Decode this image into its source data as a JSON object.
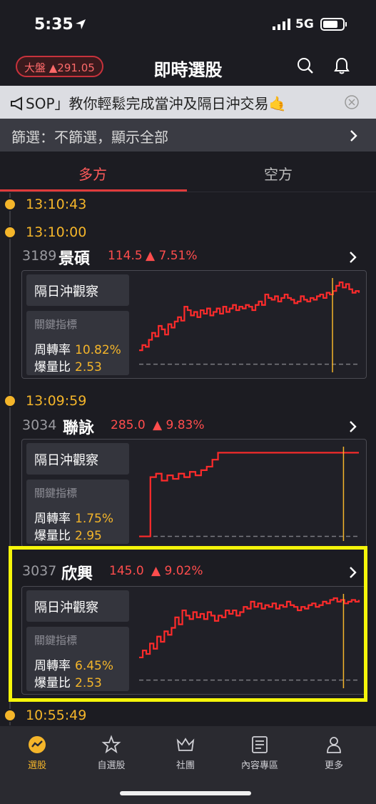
{
  "status_bar": {
    "time": "5:35",
    "network": "5G"
  },
  "header": {
    "market_label": "大盤 ▲291.05",
    "title": "即時選股"
  },
  "notice": {
    "text": "SOP」教你輕鬆完成當沖及隔日沖交易🤙"
  },
  "filter": {
    "label": "篩選：不篩選，顯示全部"
  },
  "tabs": [
    {
      "label": "多方",
      "active": true
    },
    {
      "label": "空方",
      "active": false
    }
  ],
  "timeline": [
    {
      "time": "13:10:43"
    },
    {
      "time": "13:10:00"
    },
    {
      "time": "13:09:59"
    },
    {
      "time": "10:55:49"
    }
  ],
  "stocks": [
    {
      "code": "3189",
      "name": "景碩",
      "price": "114.5",
      "change": "▲ 7.51%",
      "tag": "隔日沖觀察",
      "metrics_title": "關鍵指標",
      "turnover_label": "周轉率",
      "turnover": "10.82%",
      "volume_label": "爆量比",
      "volume_ratio": "2.53",
      "chart": {
        "values": [
          0.22,
          0.28,
          0.26,
          0.34,
          0.42,
          0.38,
          0.5,
          0.46,
          0.4,
          0.52,
          0.48,
          0.55,
          0.6,
          0.56,
          0.72,
          0.68,
          0.62,
          0.66,
          0.6,
          0.68,
          0.64,
          0.7,
          0.62,
          0.66,
          0.7,
          0.64,
          0.72,
          0.66,
          0.7,
          0.74,
          0.68,
          0.72,
          0.7,
          0.74,
          0.72,
          0.68,
          0.74,
          0.78,
          0.74,
          0.86,
          0.82,
          0.8,
          0.84,
          0.78,
          0.82,
          0.86,
          0.82,
          0.8,
          0.76,
          0.78,
          0.84,
          0.8,
          0.78,
          0.82,
          0.8,
          0.84,
          0.86,
          0.82,
          0.88,
          0.86,
          0.9,
          0.96,
          1.0,
          0.94,
          0.98,
          0.92,
          0.88,
          0.9,
          0.88
        ],
        "marker": 0.88,
        "baseline": 0.06
      }
    },
    {
      "code": "3034",
      "name": "聯詠",
      "price": "285.0",
      "change": "▲ 9.83%",
      "tag": "隔日沖觀察",
      "metrics_title": "關鍵指標",
      "turnover_label": "周轉率",
      "turnover": "1.75%",
      "volume_label": "爆量比",
      "volume_ratio": "2.95",
      "chart": {
        "values": [
          0.02,
          0.02,
          0.7,
          0.74,
          0.66,
          0.72,
          0.68,
          0.74,
          0.7,
          0.76,
          0.72,
          0.78,
          0.82,
          0.9,
          0.98,
          0.98,
          0.98,
          0.98,
          0.98,
          0.98,
          0.98,
          0.98,
          0.98,
          0.98,
          0.98,
          0.98,
          0.98,
          0.98,
          0.98,
          0.98,
          0.98,
          0.98,
          0.98,
          0.98,
          0.98,
          0.98,
          0.98,
          0.98,
          0.98,
          0.98
        ],
        "marker": 0.93,
        "baseline": 0.02
      }
    },
    {
      "code": "3037",
      "name": "欣興",
      "price": "145.0",
      "change": "▲ 9.02%",
      "tag": "隔日沖觀察",
      "metrics_title": "關鍵指標",
      "turnover_label": "周轉率",
      "turnover": "6.45%",
      "volume_label": "爆量比",
      "volume_ratio": "2.53",
      "chart": {
        "values": [
          0.32,
          0.4,
          0.36,
          0.48,
          0.42,
          0.56,
          0.5,
          0.62,
          0.58,
          0.66,
          0.78,
          0.7,
          0.86,
          0.8,
          0.76,
          0.84,
          0.78,
          0.82,
          0.76,
          0.84,
          0.8,
          0.74,
          0.8,
          0.78,
          0.86,
          0.82,
          0.86,
          0.8,
          0.84,
          0.9,
          0.88,
          0.96,
          0.9,
          0.94,
          0.88,
          0.92,
          0.9,
          0.94,
          0.88,
          0.92,
          0.9,
          0.96,
          0.92,
          0.9,
          0.86,
          0.9,
          0.88,
          0.92,
          0.94,
          0.9,
          0.92,
          0.96,
          0.94,
          0.98,
          1.0,
          0.96,
          0.98,
          0.94,
          0.96,
          0.98,
          0.96,
          0.98
        ],
        "marker": 0.93,
        "baseline": 0.06
      }
    }
  ],
  "nav": [
    {
      "label": "選股",
      "icon": "trend-icon",
      "active": true
    },
    {
      "label": "自選股",
      "icon": "star-icon",
      "active": false
    },
    {
      "label": "社團",
      "icon": "crown-icon",
      "active": false
    },
    {
      "label": "內容專區",
      "icon": "news-icon",
      "active": false
    },
    {
      "label": "更多",
      "icon": "person-icon",
      "active": false
    }
  ],
  "colors": {
    "accent": "#e03b3b",
    "gold": "#f4b52a",
    "highlight": "#f5f50a"
  }
}
